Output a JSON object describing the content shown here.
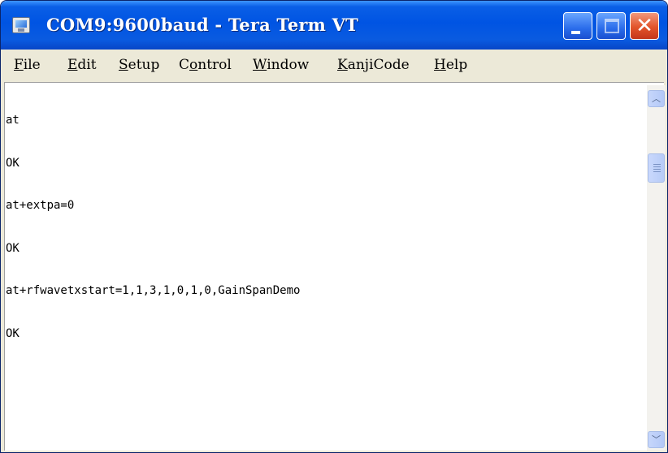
{
  "window": {
    "title": "COM9:9600baud - Tera Term VT"
  },
  "titlebar": {
    "app_icon": "tera-term-app-icon",
    "buttons": {
      "minimize": {
        "icon": "minimize-icon"
      },
      "maximize": {
        "icon": "maximize-icon"
      },
      "close": {
        "icon": "close-icon",
        "glyph": "✕"
      }
    }
  },
  "menu": {
    "items": [
      {
        "label": "File",
        "accel": "F",
        "rest": "ile"
      },
      {
        "label": "Edit",
        "accel": "E",
        "rest": "dit"
      },
      {
        "label": "Setup",
        "accel": "S",
        "rest": "etup"
      },
      {
        "label": "Control",
        "pre": "C",
        "accel": "o",
        "rest": "ntrol"
      },
      {
        "label": "Window",
        "accel": "W",
        "rest": "indow"
      },
      {
        "label": "KanjiCode",
        "accel": "K",
        "rest": "anjiCode"
      },
      {
        "label": "Help",
        "accel": "H",
        "rest": "elp"
      }
    ]
  },
  "terminal": {
    "lines": [
      "at",
      "OK",
      "at+extpa=0",
      "OK",
      "at+rfwavetxstart=1,1,3,1,0,1,0,GainSpanDemo",
      "OK"
    ]
  },
  "scrollbar": {
    "up_icon": "chevron-up-icon",
    "down_icon": "chevron-down-icon",
    "up_glyph": "︿",
    "down_glyph": "﹀"
  },
  "colors": {
    "titlebar": "#0054e3",
    "close_button": "#e2542a",
    "window_frame": "#ece9d8",
    "terminal_bg": "#ffffff",
    "terminal_fg": "#000000"
  }
}
